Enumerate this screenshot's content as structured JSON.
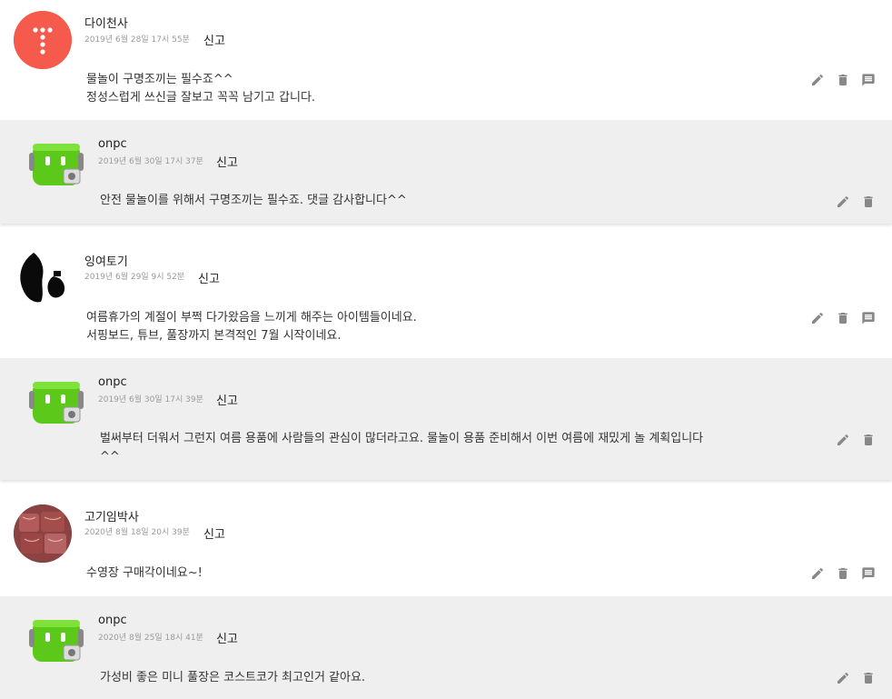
{
  "report_label": "신고",
  "threads": [
    {
      "comment": {
        "author": "다이천사",
        "date": "2019년 6월 28일 17시 55분",
        "body": "물놀이 구명조끼는 필수죠^^\n정성스럽게 쓰신글 잘보고 꼭꼭 남기고 갑니다.",
        "avatar": "red-dots-avatar"
      },
      "reply": {
        "author": "onpc",
        "date": "2019년 6월 30일 17시 37분",
        "body": "안전 물놀이를 위해서 구명조끼는 필수죠. 댓글 감사합니다^^",
        "avatar": "green-robot-avatar"
      }
    },
    {
      "comment": {
        "author": "잉여토기",
        "date": "2019년 6월 29일 9시 52분",
        "body": "여름휴가의 계절이 부쩍 다가왔음을 느끼게 해주는 아이템들이네요.\n서핑보드, 튜브, 풀장까지 본격적인 7월 시작이네요.",
        "avatar": "black-pottery-avatar"
      },
      "reply": {
        "author": "onpc",
        "date": "2019년 6월 30일 17시 39분",
        "body": "벌써부터 더워서 그런지 여름 용품에 사람들의 관심이 많더라고요. 물놀이 용품 준비해서 이번 여름에 재밌게 놀 계획입니다\n^^",
        "avatar": "green-robot-avatar"
      }
    },
    {
      "comment": {
        "author": "고기임박사",
        "date": "2020년 8월 18일 20시 39분",
        "body": "수영장 구매각이네요~!",
        "avatar": "meat-photo-avatar"
      },
      "reply": {
        "author": "onpc",
        "date": "2020년 8월 25일 18시 41분",
        "body": "가성비 좋은 미니 풀장은 코스트코가 최고인거 같아요.",
        "avatar": "green-robot-avatar"
      }
    }
  ],
  "colors": {
    "reply_bg": "#efefef",
    "icon": "#888888",
    "date": "#9a9a9a"
  },
  "icons": [
    "edit-icon",
    "delete-icon",
    "reply-icon"
  ]
}
